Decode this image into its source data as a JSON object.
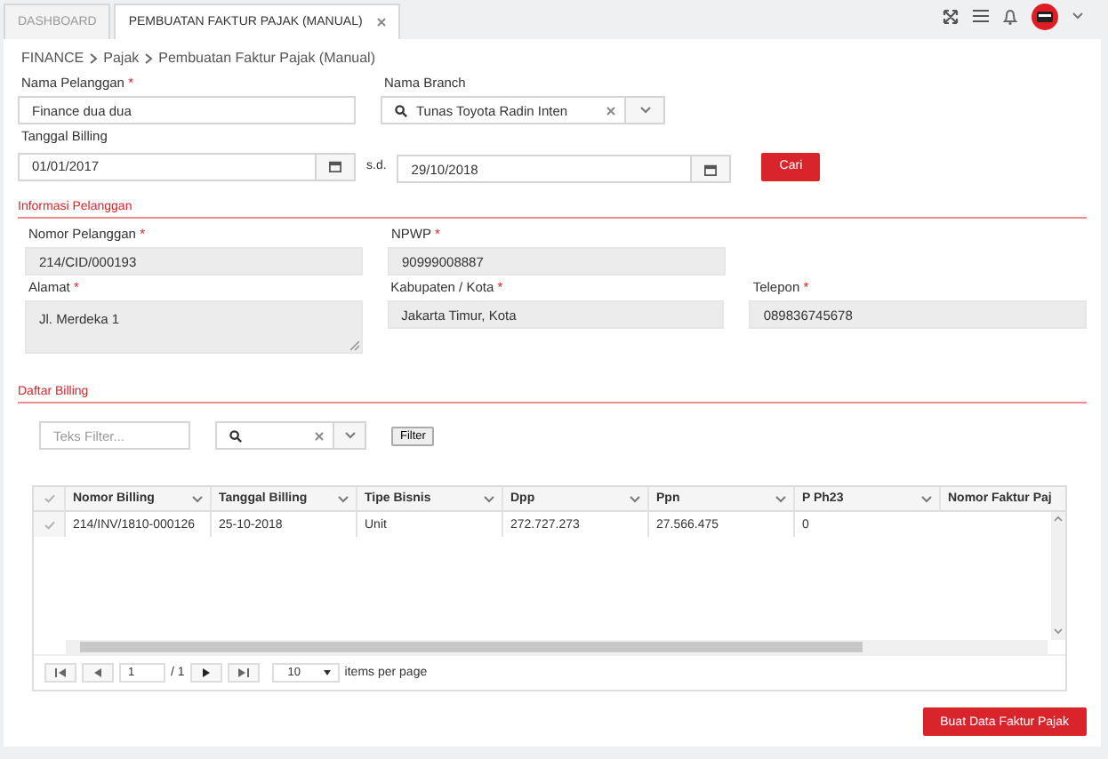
{
  "tabs": [
    {
      "label": "DASHBOARD",
      "selected": false,
      "closable": false
    },
    {
      "label": "PEMBUATAN FAKTUR PAJAK (MANUAL)",
      "selected": true,
      "closable": true
    }
  ],
  "breadcrumb": [
    "FINANCE",
    "Pajak",
    "Pembuatan Faktur Pajak (Manual)"
  ],
  "search_form": {
    "nama_pelanggan": {
      "label": "Nama Pelanggan",
      "required_mark": "*",
      "value": "Finance dua dua"
    },
    "nama_branch": {
      "label": "Nama Branch",
      "value": "Tunas Toyota Radin Inten"
    },
    "tanggal_billing": {
      "label": "Tanggal Billing",
      "from": "01/01/2017",
      "separator": "s.d.",
      "to": "29/10/2018"
    },
    "button": "Cari"
  },
  "informasi_pelanggan": {
    "title": "Informasi Pelanggan",
    "rows": [
      [
        {
          "label": "Nomor Pelanggan",
          "required_mark": "*",
          "value": "214/CID/000193",
          "kind": "input"
        },
        {
          "label": "NPWP",
          "required_mark": "*",
          "value": "90999008887",
          "kind": "input"
        }
      ],
      [
        {
          "label": "Alamat",
          "required_mark": "*",
          "value": "Jl. Merdeka 1",
          "kind": "textarea"
        },
        {
          "label": "Kabupaten / Kota",
          "required_mark": "*",
          "value": "Jakarta Timur, Kota",
          "kind": "input"
        },
        {
          "label": "Telepon",
          "required_mark": "*",
          "value": "089836745678",
          "kind": "input"
        }
      ]
    ]
  },
  "daftar_billing": {
    "title": "Daftar Billing",
    "filter_placeholder": "Teks Filter...",
    "filter_button": "Filter",
    "table": {
      "header_checked": false,
      "columns": [
        "Nomor Billing",
        "Tanggal Billing",
        "Tipe Bisnis",
        "Dpp",
        "Ppn",
        "P Ph23",
        "Nomor Faktur Paj"
      ],
      "rows": [
        {
          "checked": false,
          "cells": [
            "214/INV/1810-000126",
            "25-10-2018",
            "Unit",
            "272.727.273",
            "27.566.475",
            "0",
            ""
          ]
        }
      ]
    },
    "pager": {
      "page": "1",
      "of": "/ 1",
      "per_page": "10",
      "per_page_label": "items per page"
    }
  },
  "footer_button": "Buat Data Faktur Pajak"
}
